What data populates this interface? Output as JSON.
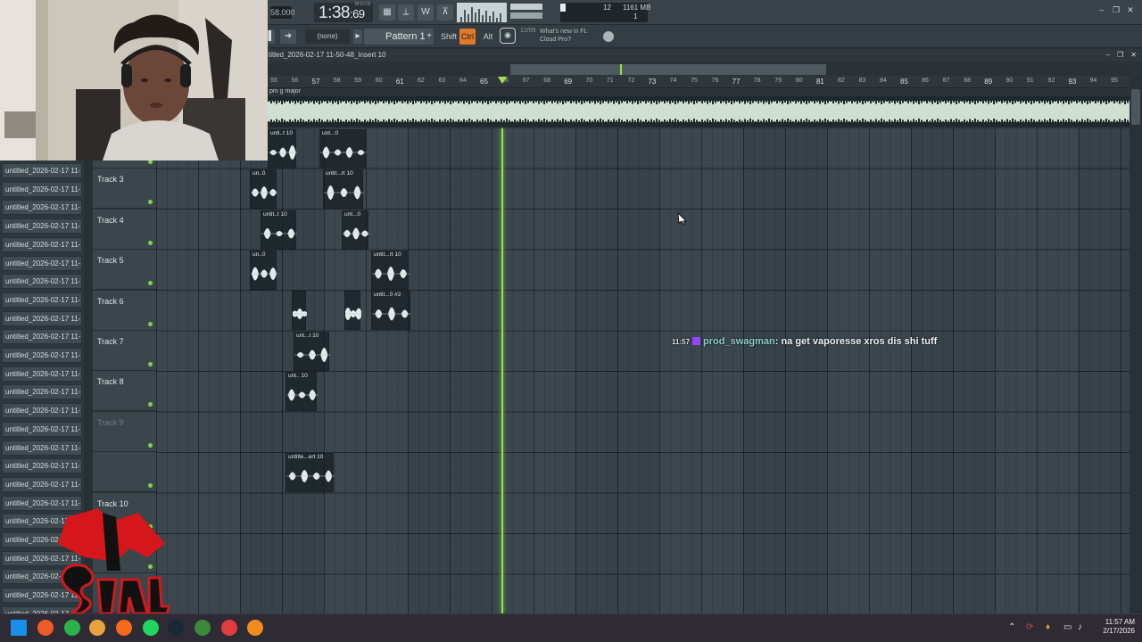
{
  "transport": {
    "tempo_label": "58.000",
    "time_main": "1:38",
    "time_sub": ":69",
    "time_mode": "M:S:CS",
    "cpu_value": "12",
    "memory": "1161 MB",
    "voices": "1"
  },
  "toolbar2": {
    "snap_select": "(none)",
    "pattern_label": "Pattern 1",
    "shift_label": "Shift",
    "ctrl_label": "Ctrl",
    "alt_label": "Alt",
    "news_date": "12/09",
    "news_text": "What's new in FL Cloud Pro?"
  },
  "playlist": {
    "title": "titled_2026-02-17 11-50-48_Insert 10",
    "key_label": "pm g major",
    "ruler": [
      "55",
      "56",
      "57",
      "58",
      "59",
      "60",
      "61",
      "62",
      "63",
      "64",
      "65",
      "66",
      "67",
      "68",
      "69",
      "70",
      "71",
      "72",
      "73",
      "74",
      "75",
      "76",
      "77",
      "78",
      "79",
      "80",
      "81",
      "82",
      "83",
      "84",
      "85",
      "86",
      "87",
      "88",
      "89",
      "90",
      "91",
      "92",
      "93",
      "94",
      "95"
    ],
    "tracks": [
      "",
      "Track 3",
      "Track 4",
      "Track 5",
      "Track 6",
      "Track 7",
      "Track 8",
      "Track 9",
      "",
      "Track 10",
      "Track 11",
      "",
      ""
    ],
    "clips": [
      {
        "title": "unti..t 10"
      },
      {
        "title": "unt...0"
      },
      {
        "title": "un..0"
      },
      {
        "title": "untit...rt 10"
      },
      {
        "title": "untit..t 10"
      },
      {
        "title": "unt...0"
      },
      {
        "title": "un..0"
      },
      {
        "title": "untit...rt 10"
      },
      {
        "title": ""
      },
      {
        "title": ""
      },
      {
        "title": "untit...0 #2"
      },
      {
        "title": "unt...t 10"
      },
      {
        "title": "unt.. 10"
      },
      {
        "title": "untitle...ert 10"
      }
    ]
  },
  "browser": {
    "items": [
      "untitled_2026-02-17 11-...",
      "untitled_2026-02-17 11-...",
      "untitled_2026-02-17 11-...",
      "untitled_2026-02-17 11-...",
      "untitled_2026-02-17 11-...",
      "untitled_2026-02-17 11-...",
      "untitled_2026-02-17 11-...",
      "untitled_2026-02-17 11-...",
      "untitled_2026-02-17 11-...",
      "untitled_2026-02-17 11-...",
      "untitled_2026-02-17 11-...",
      "untitled_2026-02-17 11-...",
      "untitled_2026-02-17 11-...",
      "untitled_2026-02-17 11-...",
      "untitled_2026-02-17 11-...",
      "untitled_2026-02-17 11-...",
      "untitled_2026-02-17 11-...",
      "untitled_2026-02-17 11-...",
      "untitled_2026-02-17 11-...",
      "untitled_2026-02-17 11-...",
      "untitled_2026-02-17 11-...",
      "untitled_2026-02-17 11-...",
      "untitled_2026-02-17 11-...",
      "untitled_2026-02-17 11-...",
      "untitled_2026-02-17 11-..."
    ]
  },
  "chat": {
    "time": "11:57",
    "user": "prod_swagman",
    "message": "na get vaporesse xros dis shi tuff"
  },
  "taskbar": {
    "clock_time": "11:57 AM",
    "clock_date": "2/17/2026",
    "icons": [
      "windows-start-icon",
      "brave-icon",
      "chrome-icon",
      "browser-icon",
      "app-icon",
      "spotify-icon",
      "steam-icon",
      "game-icon",
      "obs-icon",
      "fl-studio-icon"
    ]
  },
  "colors": {
    "playhead": "#8de244",
    "ctrl_active": "#e07a2c",
    "accent_green": "#7ad54b"
  }
}
